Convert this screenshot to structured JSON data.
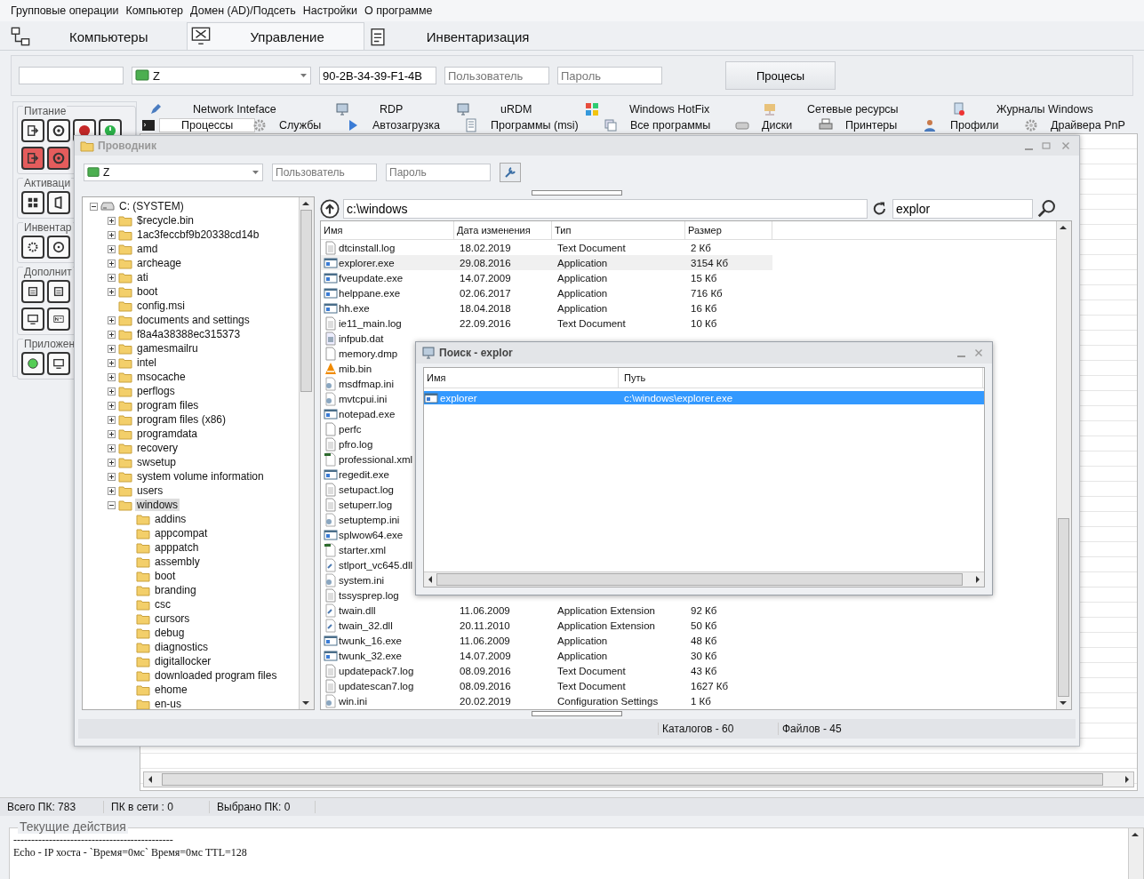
{
  "menu": [
    "Групповые операции",
    "Компьютер",
    "Домен (AD)/Подсеть",
    "Настройки",
    "О программе"
  ],
  "tabs": [
    {
      "label": "Компьютеры",
      "selected": false
    },
    {
      "label": "Управление",
      "selected": true
    },
    {
      "label": "Инвентаризация",
      "selected": false
    }
  ],
  "connection": {
    "computer": "Z",
    "mac": "90-2B-34-39-F1-4B",
    "user_placeholder": "Пользователь",
    "password_placeholder": "Пароль",
    "button": "Процесы"
  },
  "side_groups": [
    {
      "title": "Питание"
    },
    {
      "title": "Активаци"
    },
    {
      "title": "Инвентар"
    },
    {
      "title": "Дополнит"
    },
    {
      "title": "Приложен"
    }
  ],
  "action_rows": [
    [
      {
        "label": "Network Inteface",
        "selected": false
      },
      {
        "label": "RDP",
        "selected": false
      },
      {
        "label": "uRDM",
        "selected": false
      },
      {
        "label": "Windows HotFix",
        "selected": false
      },
      {
        "label": "Сетевые ресурсы",
        "selected": false
      },
      {
        "label": "Журналы Windows",
        "selected": false
      }
    ],
    [
      {
        "label": "Процессы",
        "selected": true
      },
      {
        "label": "Службы",
        "selected": false
      },
      {
        "label": "Автозагрузка",
        "selected": false
      },
      {
        "label": "Программы (msi)",
        "selected": false
      },
      {
        "label": "Все программы",
        "selected": false
      },
      {
        "label": "Диски",
        "selected": false
      },
      {
        "label": "Принтеры",
        "selected": false
      },
      {
        "label": "Профили",
        "selected": false
      },
      {
        "label": "Драйвера PnP",
        "selected": false
      }
    ]
  ],
  "explorer": {
    "title": "Проводник",
    "computer": "Z",
    "user_placeholder": "Пользователь",
    "password_placeholder": "Пароль",
    "path": "c:\\windows",
    "search": "explor",
    "tree": [
      {
        "label": "C: (SYSTEM)",
        "kind": "drive",
        "expanded": true,
        "selected": false,
        "children": [
          {
            "label": "$recycle.bin",
            "expanded": false,
            "selected": false
          },
          {
            "label": "1ac3feccbf9b20338cd14b",
            "expanded": false,
            "selected": false
          },
          {
            "label": "amd",
            "expanded": false,
            "selected": false
          },
          {
            "label": "archeage",
            "expanded": false,
            "selected": false
          },
          {
            "label": "ati",
            "expanded": false,
            "selected": false
          },
          {
            "label": "boot",
            "expanded": false,
            "selected": false
          },
          {
            "label": "config.msi",
            "selected": false
          },
          {
            "label": "documents and settings",
            "expanded": false,
            "selected": false
          },
          {
            "label": "f8a4a38388ec315373",
            "expanded": false,
            "selected": false
          },
          {
            "label": "gamesmailru",
            "expanded": false,
            "selected": false
          },
          {
            "label": "intel",
            "expanded": false,
            "selected": false
          },
          {
            "label": "msocache",
            "expanded": false,
            "selected": false
          },
          {
            "label": "perflogs",
            "expanded": false,
            "selected": false
          },
          {
            "label": "program files",
            "expanded": false,
            "selected": false
          },
          {
            "label": "program files (x86)",
            "expanded": false,
            "selected": false
          },
          {
            "label": "programdata",
            "expanded": false,
            "selected": false
          },
          {
            "label": "recovery",
            "expanded": false,
            "selected": false
          },
          {
            "label": "swsetup",
            "expanded": false,
            "selected": false
          },
          {
            "label": "system volume information",
            "expanded": false,
            "selected": false
          },
          {
            "label": "users",
            "expanded": false,
            "selected": false
          },
          {
            "label": "windows",
            "expanded": true,
            "selected": true,
            "children": [
              {
                "label": "addins",
                "selected": false
              },
              {
                "label": "appcompat",
                "selected": false
              },
              {
                "label": "apppatch",
                "selected": false
              },
              {
                "label": "assembly",
                "selected": false
              },
              {
                "label": "boot",
                "selected": false
              },
              {
                "label": "branding",
                "selected": false
              },
              {
                "label": "csc",
                "selected": false
              },
              {
                "label": "cursors",
                "selected": false
              },
              {
                "label": "debug",
                "selected": false
              },
              {
                "label": "diagnostics",
                "selected": false
              },
              {
                "label": "digitallocker",
                "selected": false
              },
              {
                "label": "downloaded program files",
                "selected": false
              },
              {
                "label": "ehome",
                "selected": false
              },
              {
                "label": "en-us",
                "selected": false
              }
            ]
          }
        ]
      }
    ],
    "columns": [
      "Имя",
      "Дата изменения",
      "Тип",
      "Размер"
    ],
    "files": [
      {
        "name": "dtcinstall.log",
        "kind": "text",
        "date": "18.02.2019",
        "type": "Text Document",
        "size": "2 Кб",
        "selected": false
      },
      {
        "name": "explorer.exe",
        "kind": "app",
        "date": "29.08.2016",
        "type": "Application",
        "size": "3154 Кб",
        "selected": true
      },
      {
        "name": "fveupdate.exe",
        "kind": "app",
        "date": "14.07.2009",
        "type": "Application",
        "size": "15 Кб",
        "selected": false
      },
      {
        "name": "helppane.exe",
        "kind": "app",
        "date": "02.06.2017",
        "type": "Application",
        "size": "716 Кб",
        "selected": false
      },
      {
        "name": "hh.exe",
        "kind": "app",
        "date": "18.04.2018",
        "type": "Application",
        "size": "16 Кб",
        "selected": false
      },
      {
        "name": "ie11_main.log",
        "kind": "text",
        "date": "22.09.2016",
        "type": "Text Document",
        "size": "10 Кб",
        "selected": false
      },
      {
        "name": "infpub.dat",
        "kind": "data",
        "selected": false
      },
      {
        "name": "memory.dmp",
        "kind": "blank",
        "selected": false
      },
      {
        "name": "mib.bin",
        "kind": "media",
        "selected": false
      },
      {
        "name": "msdfmap.ini",
        "kind": "config",
        "selected": false
      },
      {
        "name": "mvtcpui.ini",
        "kind": "config",
        "selected": false
      },
      {
        "name": "notepad.exe",
        "kind": "app",
        "selected": false
      },
      {
        "name": "perfc",
        "kind": "blank",
        "selected": false
      },
      {
        "name": "pfro.log",
        "kind": "text",
        "selected": false
      },
      {
        "name": "professional.xml",
        "kind": "xml",
        "selected": false
      },
      {
        "name": "regedit.exe",
        "kind": "app",
        "selected": false
      },
      {
        "name": "setupact.log",
        "kind": "text",
        "selected": false
      },
      {
        "name": "setuperr.log",
        "kind": "text",
        "selected": false
      },
      {
        "name": "setuptemp.ini",
        "kind": "config",
        "selected": false
      },
      {
        "name": "splwow64.exe",
        "kind": "app",
        "selected": false
      },
      {
        "name": "starter.xml",
        "kind": "xml",
        "selected": false
      },
      {
        "name": "stlport_vc645.dll",
        "kind": "ext",
        "selected": false
      },
      {
        "name": "system.ini",
        "kind": "config",
        "selected": false
      },
      {
        "name": "tssysprep.log",
        "kind": "text",
        "selected": false
      },
      {
        "name": "twain.dll",
        "kind": "ext",
        "date": "11.06.2009",
        "type": "Application Extension",
        "size": "92 Кб",
        "selected": false
      },
      {
        "name": "twain_32.dll",
        "kind": "ext",
        "date": "20.11.2010",
        "type": "Application Extension",
        "size": "50 Кб",
        "selected": false
      },
      {
        "name": "twunk_16.exe",
        "kind": "app",
        "date": "11.06.2009",
        "type": "Application",
        "size": "48 Кб",
        "selected": false
      },
      {
        "name": "twunk_32.exe",
        "kind": "app",
        "date": "14.07.2009",
        "type": "Application",
        "size": "30 Кб",
        "selected": false
      },
      {
        "name": "updatepack7.log",
        "kind": "text",
        "date": "08.09.2016",
        "type": "Text Document",
        "size": "43 Кб",
        "selected": false
      },
      {
        "name": "updatescan7.log",
        "kind": "text",
        "date": "08.09.2016",
        "type": "Text Document",
        "size": "1627 Кб",
        "selected": false
      },
      {
        "name": "win.ini",
        "kind": "config",
        "date": "20.02.2019",
        "type": "Configuration Settings",
        "size": "1 Кб",
        "selected": false
      }
    ],
    "status": [
      "Каталогов - 60",
      "Файлов - 45"
    ]
  },
  "search_dialog": {
    "title": "Поиск - explor",
    "columns": [
      "Имя",
      "Путь"
    ],
    "results": [
      {
        "name": "explorer",
        "path": "c:\\windows\\explorer.exe",
        "selected": true
      }
    ]
  },
  "status_bar": [
    "Всего ПК: 783",
    "ПК в сети : 0",
    "Выбрано ПК: 0"
  ],
  "log": {
    "title": "Текущие действия",
    "lines": [
      "---------------------------------------------",
      "Echo - IP хоста - `Время=0мс`   Время=0мс  TTL=128"
    ]
  }
}
